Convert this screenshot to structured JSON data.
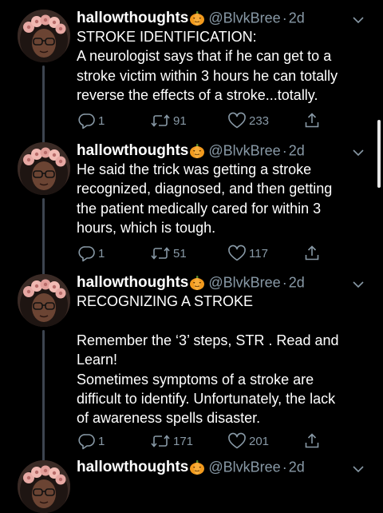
{
  "colors": {
    "background": "#000000",
    "text": "#ffffff",
    "secondary": "#8899a6"
  },
  "tweets": [
    {
      "display_name": "hallowthoughts",
      "handle": "@BlvkBree",
      "sep": "·",
      "time": "2d",
      "lines": [
        "STROKE IDENTIFICATION:",
        "A neurologist says that if he can get to a",
        "stroke victim within 3 hours he can totally",
        "reverse the effects of a stroke...totally."
      ],
      "replies": "1",
      "retweets": "91",
      "likes": "233"
    },
    {
      "display_name": "hallowthoughts",
      "handle": "@BlvkBree",
      "sep": "·",
      "time": "2d",
      "lines": [
        "He said the trick was getting a stroke",
        "recognized, diagnosed, and then getting",
        "the patient medically cared for within 3",
        "hours, which is tough."
      ],
      "replies": "1",
      "retweets": "51",
      "likes": "117"
    },
    {
      "display_name": "hallowthoughts",
      "handle": "@BlvkBree",
      "sep": "·",
      "time": "2d",
      "lines": [
        "RECOGNIZING A STROKE",
        "",
        "Remember the ‘3’ steps, STR . Read and",
        "Learn!",
        "Sometimes symptoms of a stroke are",
        "difficult to identify. Unfortunately, the lack",
        "of awareness spells disaster."
      ],
      "replies": "1",
      "retweets": "171",
      "likes": "201"
    },
    {
      "display_name": "hallowthoughts",
      "handle": "@BlvkBree",
      "sep": "·",
      "time": "2d",
      "lines": []
    }
  ],
  "icons": {
    "pumpkin": "jack-o-lantern-emoji",
    "reply": "reply-icon",
    "retweet": "retweet-icon",
    "like": "heart-icon",
    "share": "share-icon",
    "more": "chevron-down-icon"
  }
}
